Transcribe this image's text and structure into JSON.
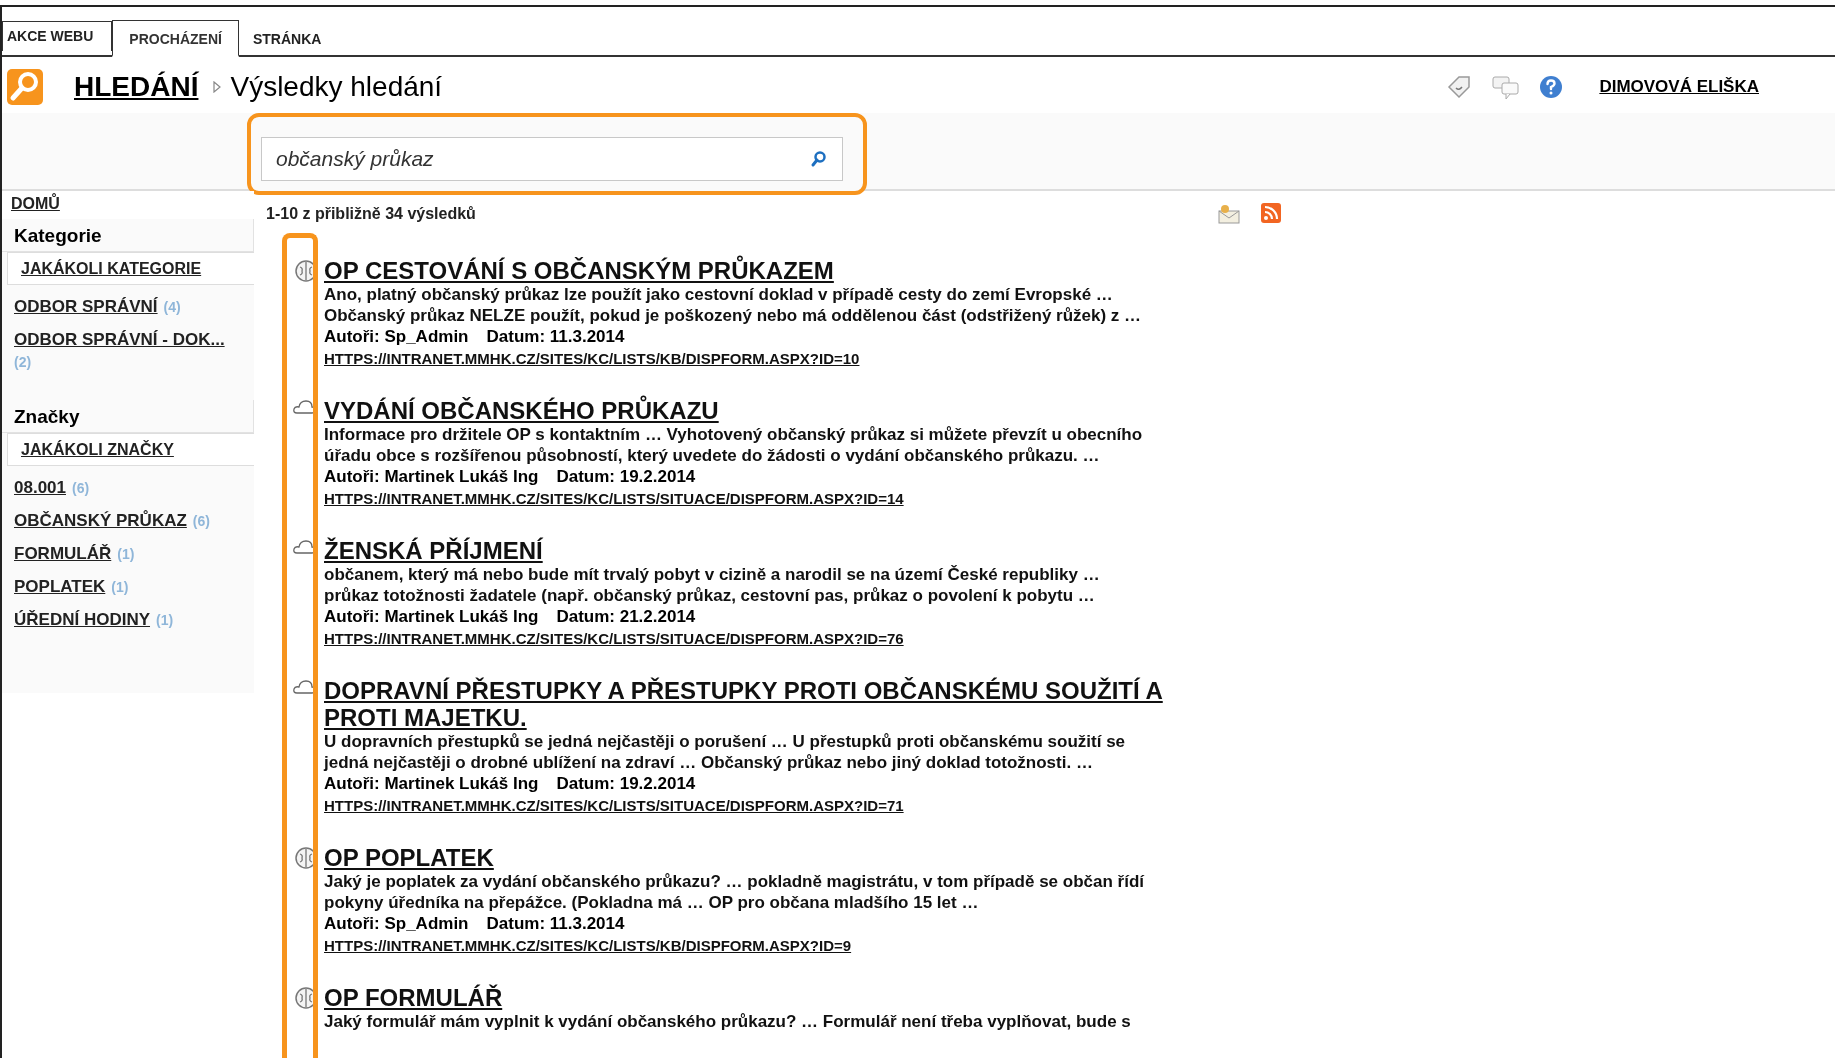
{
  "ribbon_tabs": [
    {
      "label": "AKCE WEBU",
      "selected": false
    },
    {
      "label": "PROCHÁZENÍ",
      "selected": true
    },
    {
      "label": "STRÁNKA",
      "selected": false
    }
  ],
  "header": {
    "breadcrumb_root": "HLEDÁNÍ",
    "page_title": "Výsledky hledání",
    "user": "DIMOVOVÁ ELIŠKA"
  },
  "search": {
    "value": "občanský průkaz"
  },
  "sidebar": {
    "home": "DOMŮ",
    "sections": [
      {
        "title": "Kategorie",
        "any": "JAKÁKOLI KATEGORIE",
        "items": [
          {
            "label": "ODBOR SPRÁVNÍ",
            "count": "(4)"
          },
          {
            "label": "ODBOR SPRÁVNÍ - DOK...",
            "count": "(2)"
          }
        ]
      },
      {
        "title": "Značky",
        "any": "JAKÁKOLI ZNAČKY",
        "items": [
          {
            "label": "08.001",
            "count": "(6)"
          },
          {
            "label": "OBČANSKÝ PRŮKAZ",
            "count": "(6)"
          },
          {
            "label": "FORMULÁŘ",
            "count": "(1)"
          },
          {
            "label": "POPLATEK",
            "count": "(1)"
          },
          {
            "label": "ÚŘEDNÍ HODINY",
            "count": "(1)"
          }
        ]
      }
    ]
  },
  "results_count": "1-10 z přibližně 34 výsledků",
  "results": [
    {
      "kind": "brain",
      "title": "OP CESTOVÁNÍ S OBČANSKÝM PRŮKAZEM",
      "snippet": [
        "Ano, platný občanský průkaz lze použít jako cestovní doklad v případě cesty do zemí Evropské …",
        "Občanský průkaz NELZE použít, pokud je poškozený nebo má oddělenou část (odstřižený růžek) z …"
      ],
      "authors": "Autoři: Sp_Admin",
      "date": "Datum: 11.3.2014",
      "url": "HTTPS://INTRANET.MMHK.CZ/SITES/KC/LISTS/KB/DISPFORM.ASPX?ID=10"
    },
    {
      "kind": "cloud",
      "title": "VYDÁNÍ OBČANSKÉHO PRŮKAZU",
      "snippet": [
        "Informace pro držitele OP s kontaktním … Vyhotovený občanský průkaz si můžete převzít u obecního",
        "úřadu obce s rozšířenou působností, který uvedete do žádosti o vydání občanského průkazu. …"
      ],
      "authors": "Autoři: Martinek Lukáš Ing",
      "date": "Datum: 19.2.2014",
      "url": "HTTPS://INTRANET.MMHK.CZ/SITES/KC/LISTS/SITUACE/DISPFORM.ASPX?ID=14"
    },
    {
      "kind": "cloud",
      "title": "ŽENSKÁ PŘÍJMENÍ",
      "snippet": [
        "občanem, který má nebo bude mít trvalý pobyt v cizině a narodil se na území České republiky …",
        "průkaz totožnosti žadatele (např. občanský průkaz, cestovní pas, průkaz o povolení k pobytu …"
      ],
      "authors": "Autoři: Martinek Lukáš Ing",
      "date": "Datum: 21.2.2014",
      "url": "HTTPS://INTRANET.MMHK.CZ/SITES/KC/LISTS/SITUACE/DISPFORM.ASPX?ID=76"
    },
    {
      "kind": "cloud",
      "title": "DOPRAVNÍ PŘESTUPKY A PŘESTUPKY PROTI OBČANSKÉMU SOUŽITÍ A PROTI MAJETKU.",
      "snippet": [
        "U dopravních přestupků se jedná nejčastěji o porušení … U přestupků proti občanskému soužití se",
        "jedná nejčastěji o drobné ublížení na zdraví … Občanský průkaz nebo  jiný doklad totožnosti. …"
      ],
      "authors": "Autoři: Martinek Lukáš Ing",
      "date": "Datum: 19.2.2014",
      "url": "HTTPS://INTRANET.MMHK.CZ/SITES/KC/LISTS/SITUACE/DISPFORM.ASPX?ID=71"
    },
    {
      "kind": "brain",
      "title": "OP POPLATEK",
      "snippet": [
        "Jaký je poplatek za vydání občanského průkazu? … pokladně magistrátu, v tom případě se občan řídí",
        "pokyny úředníka na přepážce. (Pokladna má … OP pro občana mladšího 15 let …"
      ],
      "authors": "Autoři: Sp_Admin",
      "date": "Datum: 11.3.2014",
      "url": "HTTPS://INTRANET.MMHK.CZ/SITES/KC/LISTS/KB/DISPFORM.ASPX?ID=9"
    },
    {
      "kind": "brain",
      "title": "OP FORMULÁŘ",
      "snippet": [
        "Jaký formulář mám vyplnit k vydání občanského průkazu? … Formulář není třeba vyplňovat, bude s"
      ]
    }
  ]
}
